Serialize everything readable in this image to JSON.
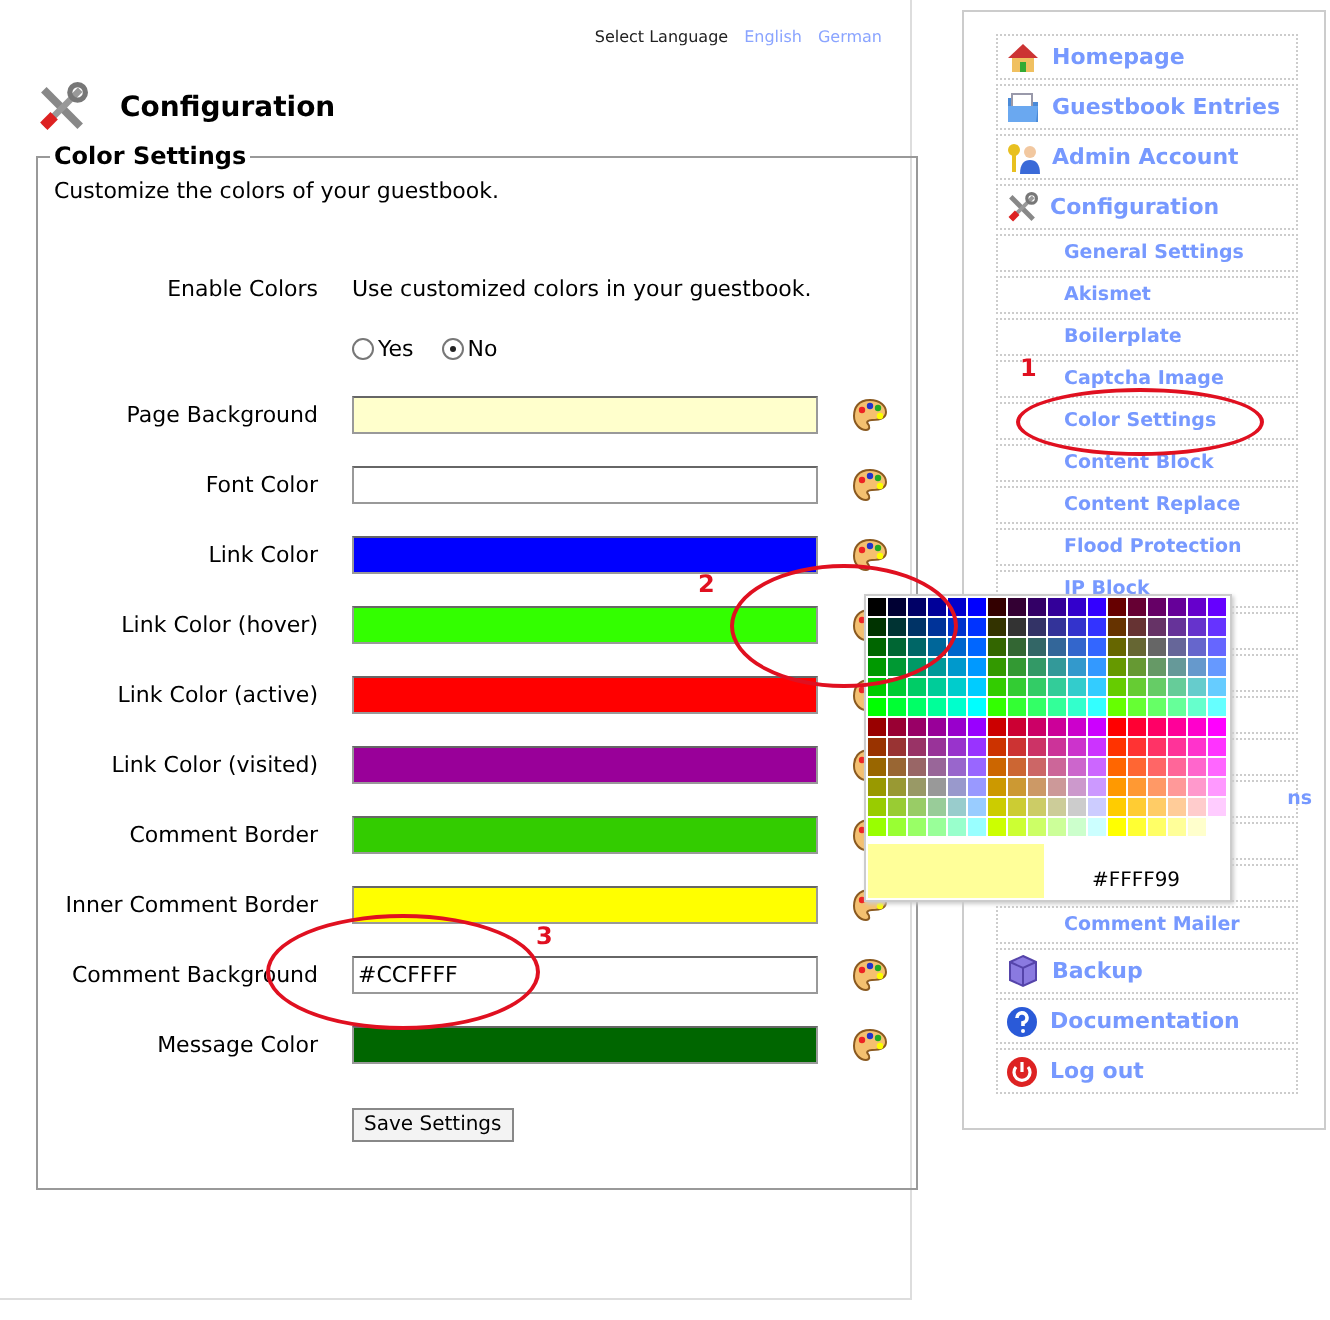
{
  "language": {
    "label": "Select Language",
    "options": [
      {
        "label": "English"
      },
      {
        "label": "German"
      }
    ]
  },
  "page": {
    "title": "Configuration"
  },
  "section": {
    "legend": "Color Settings",
    "description": "Customize the colors of your guestbook.",
    "enable": {
      "label": "Enable Colors",
      "hint": "Use customized colors in your guestbook.",
      "options": [
        {
          "label": "Yes",
          "selected": false
        },
        {
          "label": "No",
          "selected": true
        }
      ]
    },
    "fields": [
      {
        "label": "Page Background",
        "color": "#FFFFCC"
      },
      {
        "label": "Font Color",
        "color": "#FFFFFF"
      },
      {
        "label": "Link Color",
        "color": "#0000FF"
      },
      {
        "label": "Link Color (hover)",
        "color": "#33FF00"
      },
      {
        "label": "Link Color (active)",
        "color": "#FF0000"
      },
      {
        "label": "Link Color (visited)",
        "color": "#990099"
      },
      {
        "label": "Comment Border",
        "color": "#33CC00"
      },
      {
        "label": "Inner Comment Border",
        "color": "#FFFF00"
      },
      {
        "label": "Comment Background",
        "color": "#FFFFFF",
        "value": "#CCFFFF"
      },
      {
        "label": "Message Color",
        "color": "#006600"
      }
    ],
    "save": "Save Settings"
  },
  "sidebar": {
    "items": [
      {
        "kind": "main",
        "label": "Homepage"
      },
      {
        "kind": "main",
        "label": "Guestbook Entries"
      },
      {
        "kind": "main",
        "label": "Admin Account"
      },
      {
        "kind": "main",
        "label": "Configuration"
      },
      {
        "kind": "sub",
        "label": "General Settings"
      },
      {
        "kind": "sub",
        "label": "Akismet"
      },
      {
        "kind": "sub",
        "label": "Boilerplate"
      },
      {
        "kind": "sub",
        "label": "Captcha Image"
      },
      {
        "kind": "sub",
        "label": "Color Settings"
      },
      {
        "kind": "sub",
        "label": "Content Block"
      },
      {
        "kind": "sub",
        "label": "Content Replace"
      },
      {
        "kind": "sub",
        "label": "Flood Protection"
      },
      {
        "kind": "sub",
        "label": "IP Block"
      },
      {
        "kind": "hidden"
      },
      {
        "kind": "hidden"
      },
      {
        "kind": "hidden"
      },
      {
        "kind": "hidden"
      },
      {
        "kind": "fragment",
        "label": "ns"
      },
      {
        "kind": "hidden"
      },
      {
        "kind": "hidden"
      },
      {
        "kind": "sub",
        "label": "Comment Mailer"
      },
      {
        "kind": "main",
        "label": "Backup"
      },
      {
        "kind": "main",
        "label": "Documentation"
      },
      {
        "kind": "main",
        "label": "Log out"
      }
    ]
  },
  "color_picker": {
    "preview": "#FFFF99"
  },
  "annotations": [
    {
      "label": "1"
    },
    {
      "label": "2"
    },
    {
      "label": "3"
    }
  ]
}
